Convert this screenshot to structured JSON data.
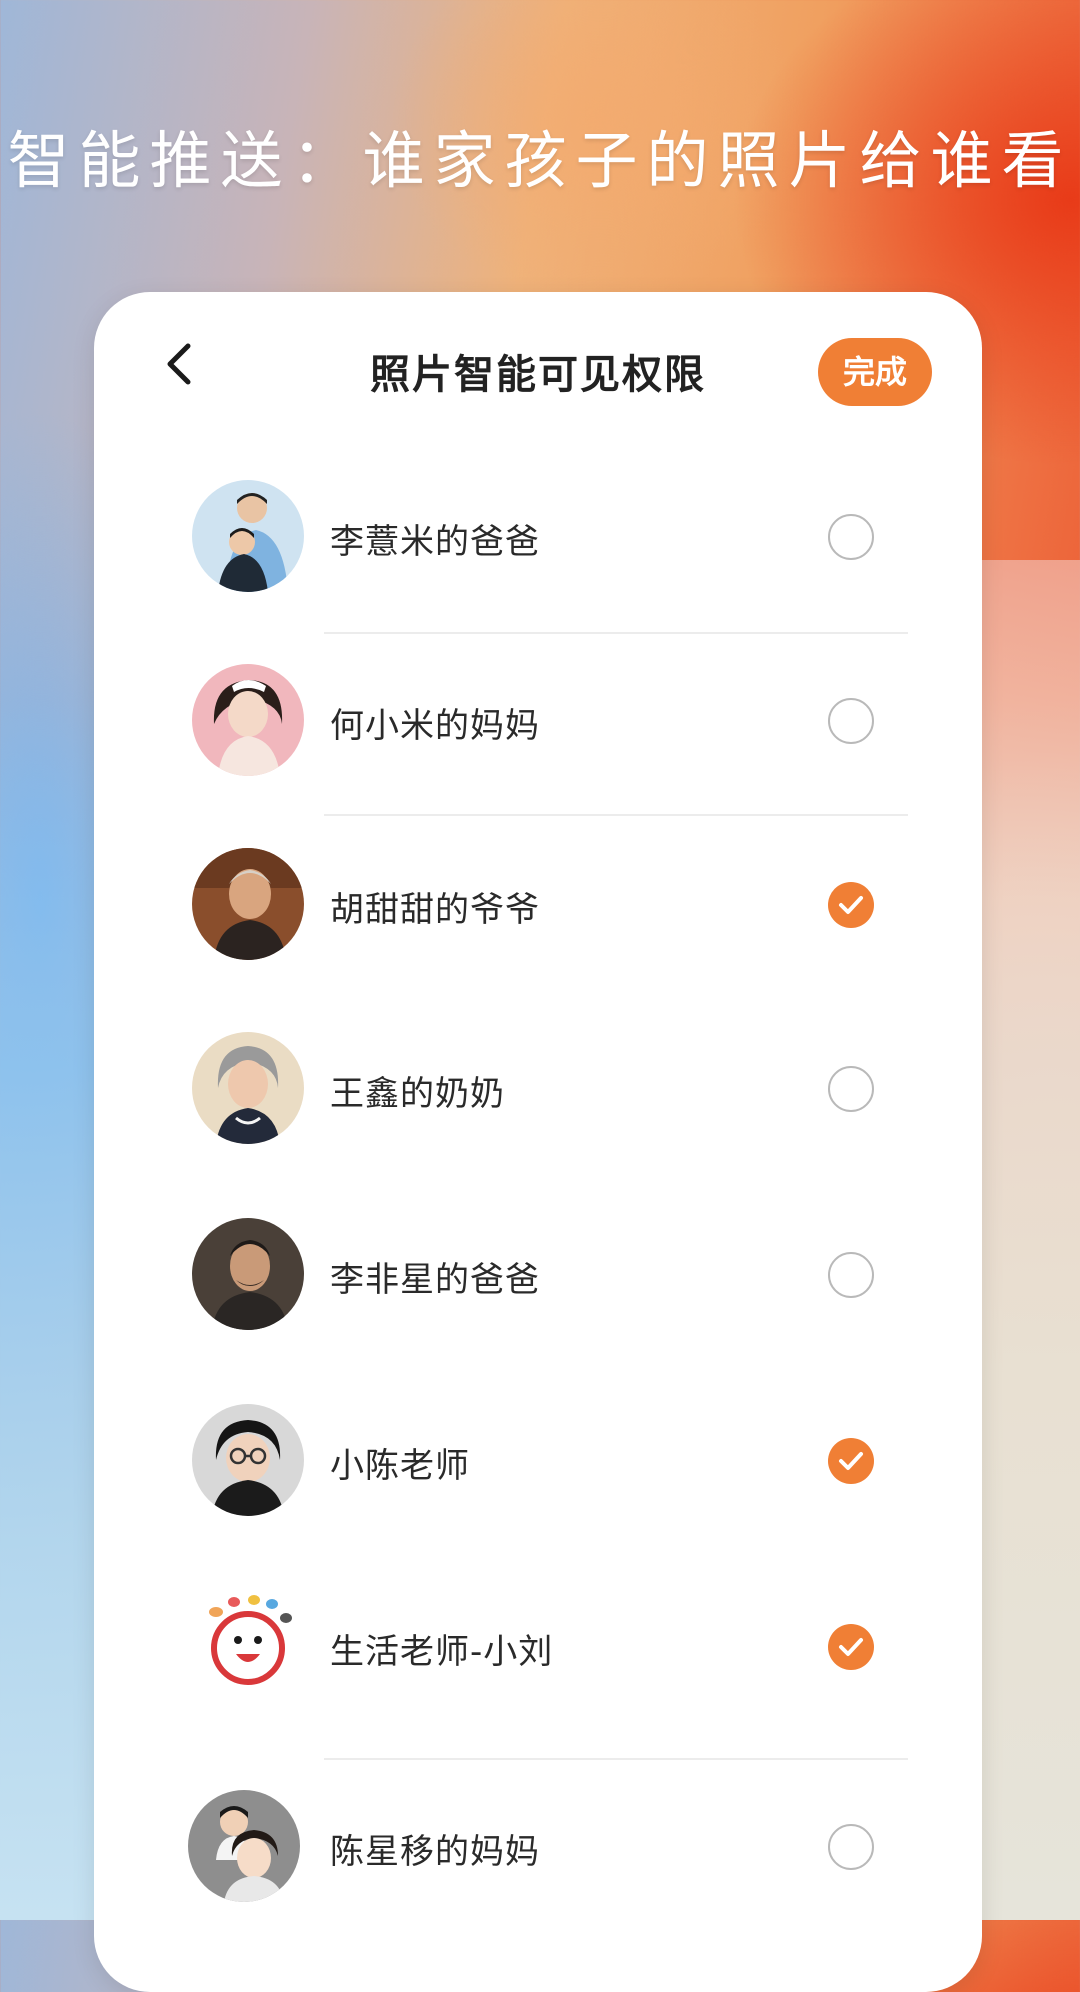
{
  "banner": {
    "title": "智能推送：谁家孩子的照片给谁看"
  },
  "header": {
    "back_icon": "chevron-left-icon",
    "title": "照片智能可见权限",
    "done_label": "完成"
  },
  "colors": {
    "accent": "#f07f35",
    "card_bg": "#ffffff",
    "radio_border": "#b9b9b9",
    "divider": "#ececec"
  },
  "contacts": [
    {
      "name": "李薏米的爸爸",
      "selected": false,
      "avatar_icon": "father-with-child-avatar"
    },
    {
      "name": "何小米的妈妈",
      "selected": false,
      "avatar_icon": "young-woman-avatar"
    },
    {
      "name": "胡甜甜的爷爷",
      "selected": true,
      "avatar_icon": "elderly-man-avatar"
    },
    {
      "name": "王鑫的奶奶",
      "selected": false,
      "avatar_icon": "elderly-woman-avatar"
    },
    {
      "name": "李非星的爸爸",
      "selected": false,
      "avatar_icon": "middle-aged-man-avatar"
    },
    {
      "name": "小陈老师",
      "selected": true,
      "avatar_icon": "boy-with-glasses-avatar"
    },
    {
      "name": "生活老师-小刘",
      "selected": true,
      "avatar_icon": "cartoon-mascot-avatar"
    },
    {
      "name": "陈星移的妈妈",
      "selected": false,
      "avatar_icon": "mother-with-child-avatar"
    }
  ]
}
